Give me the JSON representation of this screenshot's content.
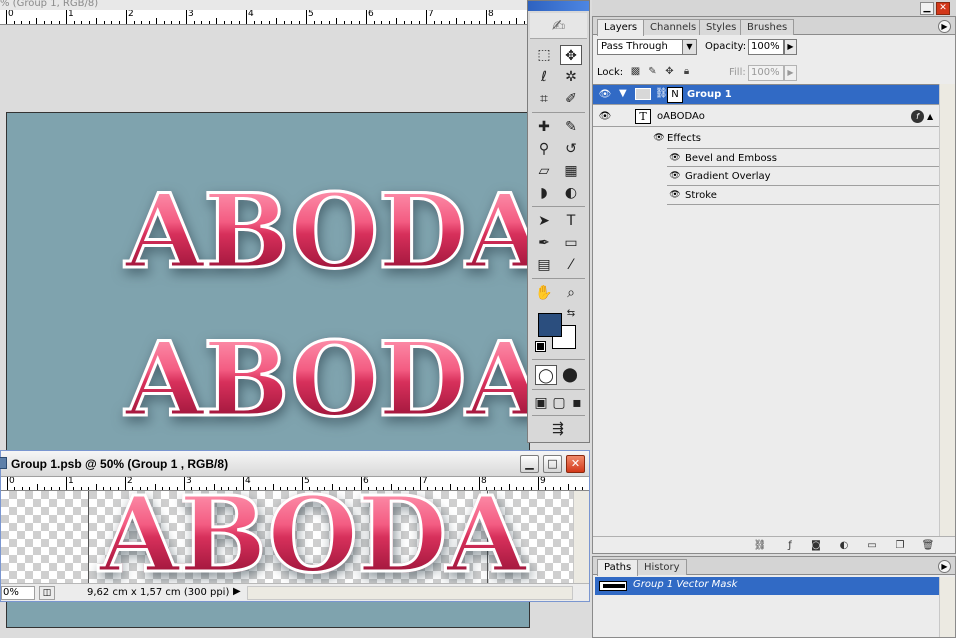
{
  "doc1": {
    "title": "% (Group 1, RGB/8)",
    "ruler_marks": [
      "0",
      "1",
      "2",
      "3",
      "4",
      "5",
      "6",
      "7",
      "8"
    ],
    "text_line1": "ABODA",
    "text_line2": "ABODA"
  },
  "doc2": {
    "title": "Group 1.psb @ 50% (Group 1 , RGB/8)",
    "minimize": "▁",
    "maximize": "□",
    "close": "✕",
    "ruler_marks": [
      "0",
      "1",
      "2",
      "3",
      "4",
      "5",
      "6",
      "7",
      "8",
      "9"
    ],
    "text": "ABODA",
    "zoom": "0%",
    "doc_size": "9,62 cm x 1,57 cm (300 ppi)",
    "status_arrow": "▶"
  },
  "toolbox": {
    "tools": [
      {
        "icon": "marquee",
        "glyph": "⬚"
      },
      {
        "icon": "move",
        "glyph": "✥"
      },
      {
        "icon": "lasso",
        "glyph": "ℓ"
      },
      {
        "icon": "magic-wand",
        "glyph": "✲"
      },
      {
        "icon": "crop",
        "glyph": "⌗"
      },
      {
        "icon": "slice",
        "glyph": "✐"
      },
      {
        "icon": "healing-brush",
        "glyph": "✚"
      },
      {
        "icon": "brush",
        "glyph": "✎"
      },
      {
        "icon": "clone-stamp",
        "glyph": "⚲"
      },
      {
        "icon": "history-brush",
        "glyph": "↺"
      },
      {
        "icon": "eraser",
        "glyph": "▱"
      },
      {
        "icon": "gradient",
        "glyph": "▦"
      },
      {
        "icon": "blur",
        "glyph": "◗"
      },
      {
        "icon": "dodge",
        "glyph": "◐"
      },
      {
        "icon": "path-selection",
        "glyph": "➤"
      },
      {
        "icon": "type",
        "glyph": "T"
      },
      {
        "icon": "pen",
        "glyph": "✒"
      },
      {
        "icon": "rectangle",
        "glyph": "▭"
      },
      {
        "icon": "notes",
        "glyph": "▤"
      },
      {
        "icon": "eyedropper",
        "glyph": "⁄"
      },
      {
        "icon": "hand",
        "glyph": "✋"
      },
      {
        "icon": "zoom",
        "glyph": "⌕"
      }
    ],
    "colors": {
      "foreground": "#2b4e7e",
      "background": "#ffffff"
    }
  },
  "layers": {
    "tabs": [
      "Layers",
      "Channels",
      "Styles",
      "Brushes"
    ],
    "active_tab": "Layers",
    "blend_mode": "Pass Through",
    "opacity_label": "Opacity:",
    "opacity": "100%",
    "lock_label": "Lock:",
    "fill_label": "Fill:",
    "fill": "100%",
    "group_name": "Group 1",
    "text_layer_name": "oABODAo",
    "effects_label": "Effects",
    "effects": [
      "Bevel and Emboss",
      "Gradient Overlay",
      "Stroke"
    ]
  },
  "paths": {
    "tabs": [
      "Paths",
      "History"
    ],
    "active_tab": "Paths",
    "path_name": "Group 1 Vector Mask"
  },
  "accent_color": "#316ac5"
}
